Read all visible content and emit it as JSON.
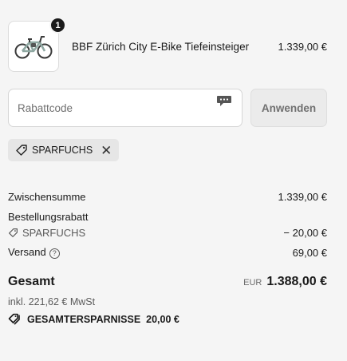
{
  "product": {
    "quantity": "1",
    "name": "BBF Zürich City E-Bike Tiefeinsteiger",
    "price": "1.339,00 €",
    "frame_color": "#8fa8a2"
  },
  "discount": {
    "placeholder": "Rabattcode",
    "apply_label": "Anwenden",
    "applied_code": "SPARFUCHS"
  },
  "summary": {
    "subtotal_label": "Zwischensumme",
    "subtotal_value": "1.339,00 €",
    "order_discount_label": "Bestellungsrabatt",
    "order_discount_code": "SPARFUCHS",
    "order_discount_value": "− 20,00 €",
    "shipping_label": "Versand",
    "shipping_value": "69,00 €"
  },
  "total": {
    "label": "Gesamt",
    "currency": "EUR",
    "value": "1.388,00 €",
    "tax_note": "inkl. 221,62 € MwSt",
    "savings_label": "GESAMTERSPARNISSE",
    "savings_value": "20,00 €"
  }
}
